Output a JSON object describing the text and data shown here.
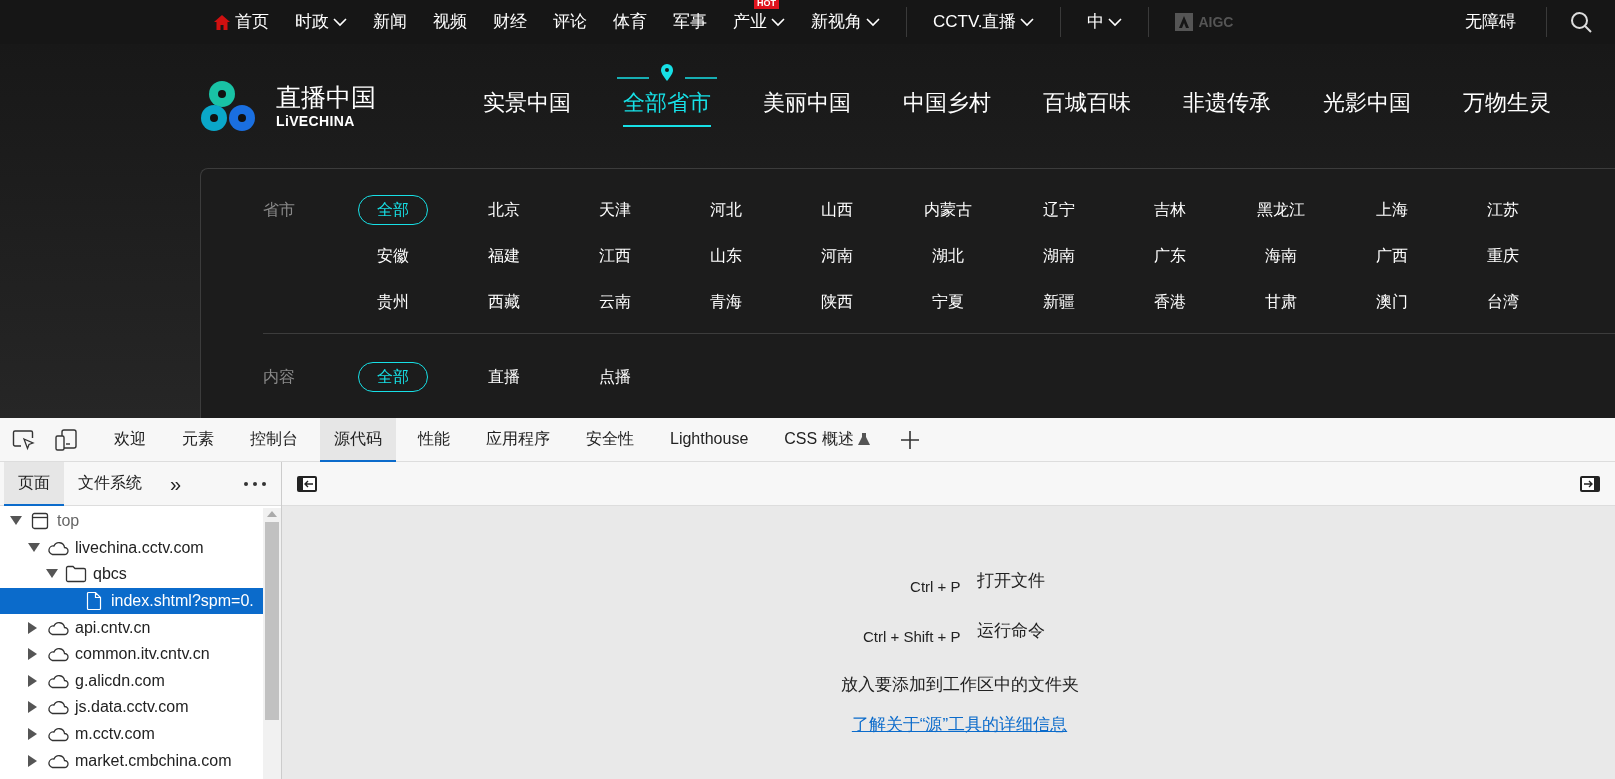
{
  "top_bar": {
    "items": [
      {
        "label": "首页",
        "kind": "home"
      },
      {
        "label": "时政",
        "kind": "dropdown"
      },
      {
        "label": "新闻",
        "kind": "link"
      },
      {
        "label": "视频",
        "kind": "link"
      },
      {
        "label": "财经",
        "kind": "link"
      },
      {
        "label": "评论",
        "kind": "link"
      },
      {
        "label": "体育",
        "kind": "link"
      },
      {
        "label": "军事",
        "kind": "link"
      },
      {
        "label": "产业",
        "kind": "dropdown",
        "badge": "HOT"
      },
      {
        "label": "新视角",
        "kind": "dropdown"
      },
      {
        "label": "CCTV.直播",
        "kind": "dropdown",
        "divider": true
      },
      {
        "label": "中",
        "kind": "dropdown",
        "divider": true
      }
    ],
    "aigc": "AIGC",
    "accessibility": "无障碍"
  },
  "logo": {
    "title": "直播中国",
    "subtitle": "LiVECHINA"
  },
  "nav": [
    {
      "label": "实景中国",
      "selected": false
    },
    {
      "label": "全部省市",
      "selected": true
    },
    {
      "label": "美丽中国",
      "selected": false
    },
    {
      "label": "中国乡村",
      "selected": false
    },
    {
      "label": "百城百味",
      "selected": false
    },
    {
      "label": "非遗传承",
      "selected": false
    },
    {
      "label": "光影中国",
      "selected": false
    },
    {
      "label": "万物生灵",
      "selected": false
    }
  ],
  "filters": [
    {
      "label": "省市",
      "options": [
        {
          "label": "全部",
          "selected": true
        },
        {
          "label": "北京",
          "selected": false
        },
        {
          "label": "天津",
          "selected": false
        },
        {
          "label": "河北",
          "selected": false
        },
        {
          "label": "山西",
          "selected": false
        },
        {
          "label": "内蒙古",
          "selected": false
        },
        {
          "label": "辽宁",
          "selected": false
        },
        {
          "label": "吉林",
          "selected": false
        },
        {
          "label": "黑龙江",
          "selected": false
        },
        {
          "label": "上海",
          "selected": false
        },
        {
          "label": "江苏",
          "selected": false
        },
        {
          "label": "安徽",
          "selected": false
        },
        {
          "label": "福建",
          "selected": false
        },
        {
          "label": "江西",
          "selected": false
        },
        {
          "label": "山东",
          "selected": false
        },
        {
          "label": "河南",
          "selected": false
        },
        {
          "label": "湖北",
          "selected": false
        },
        {
          "label": "湖南",
          "selected": false
        },
        {
          "label": "广东",
          "selected": false
        },
        {
          "label": "海南",
          "selected": false
        },
        {
          "label": "广西",
          "selected": false
        },
        {
          "label": "重庆",
          "selected": false
        },
        {
          "label": "贵州",
          "selected": false
        },
        {
          "label": "西藏",
          "selected": false
        },
        {
          "label": "云南",
          "selected": false
        },
        {
          "label": "青海",
          "selected": false
        },
        {
          "label": "陕西",
          "selected": false
        },
        {
          "label": "宁夏",
          "selected": false
        },
        {
          "label": "新疆",
          "selected": false
        },
        {
          "label": "香港",
          "selected": false
        },
        {
          "label": "甘肃",
          "selected": false
        },
        {
          "label": "澳门",
          "selected": false
        },
        {
          "label": "台湾",
          "selected": false
        }
      ]
    },
    {
      "label": "内容",
      "options": [
        {
          "label": "全部",
          "selected": true
        },
        {
          "label": "直播",
          "selected": false
        },
        {
          "label": "点播",
          "selected": false
        }
      ]
    }
  ],
  "devtools": {
    "tabs": [
      {
        "label": "欢迎",
        "selected": false
      },
      {
        "label": "元素",
        "selected": false
      },
      {
        "label": "控制台",
        "selected": false
      },
      {
        "label": "源代码",
        "selected": true
      },
      {
        "label": "性能",
        "selected": false
      },
      {
        "label": "应用程序",
        "selected": false
      },
      {
        "label": "安全性",
        "selected": false
      },
      {
        "label": "Lighthouse",
        "selected": false
      },
      {
        "label": "CSS 概述",
        "selected": false,
        "experimental": true
      }
    ],
    "sidebar_tabs": [
      {
        "label": "页面",
        "selected": true
      },
      {
        "label": "文件系统",
        "selected": false
      }
    ],
    "more_tabs": "»",
    "tree": [
      {
        "label": "top",
        "kind": "frame",
        "expanded": true,
        "children": [
          {
            "label": "livechina.cctv.com",
            "kind": "domain",
            "expanded": true,
            "children": [
              {
                "label": "qbcs",
                "kind": "folder",
                "expanded": true,
                "children": [
                  {
                    "label": "index.shtml?spm=0.",
                    "kind": "file",
                    "selected": true
                  }
                ]
              }
            ]
          },
          {
            "label": "api.cntv.cn",
            "kind": "domain",
            "expanded": false
          },
          {
            "label": "common.itv.cntv.cn",
            "kind": "domain",
            "expanded": false
          },
          {
            "label": "g.alicdn.com",
            "kind": "domain",
            "expanded": false
          },
          {
            "label": "js.data.cctv.com",
            "kind": "domain",
            "expanded": false
          },
          {
            "label": "m.cctv.com",
            "kind": "domain",
            "expanded": false
          },
          {
            "label": "market.cmbchina.com",
            "kind": "domain",
            "expanded": false
          }
        ]
      }
    ],
    "shortcuts": [
      {
        "keys": "Ctrl + P",
        "action": "打开文件"
      },
      {
        "keys": "Ctrl + Shift + P",
        "action": "运行命令"
      }
    ],
    "drop_hint": "放入要添加到工作区中的文件夹",
    "learn_more": "了解关于“源”工具的详细信息"
  }
}
